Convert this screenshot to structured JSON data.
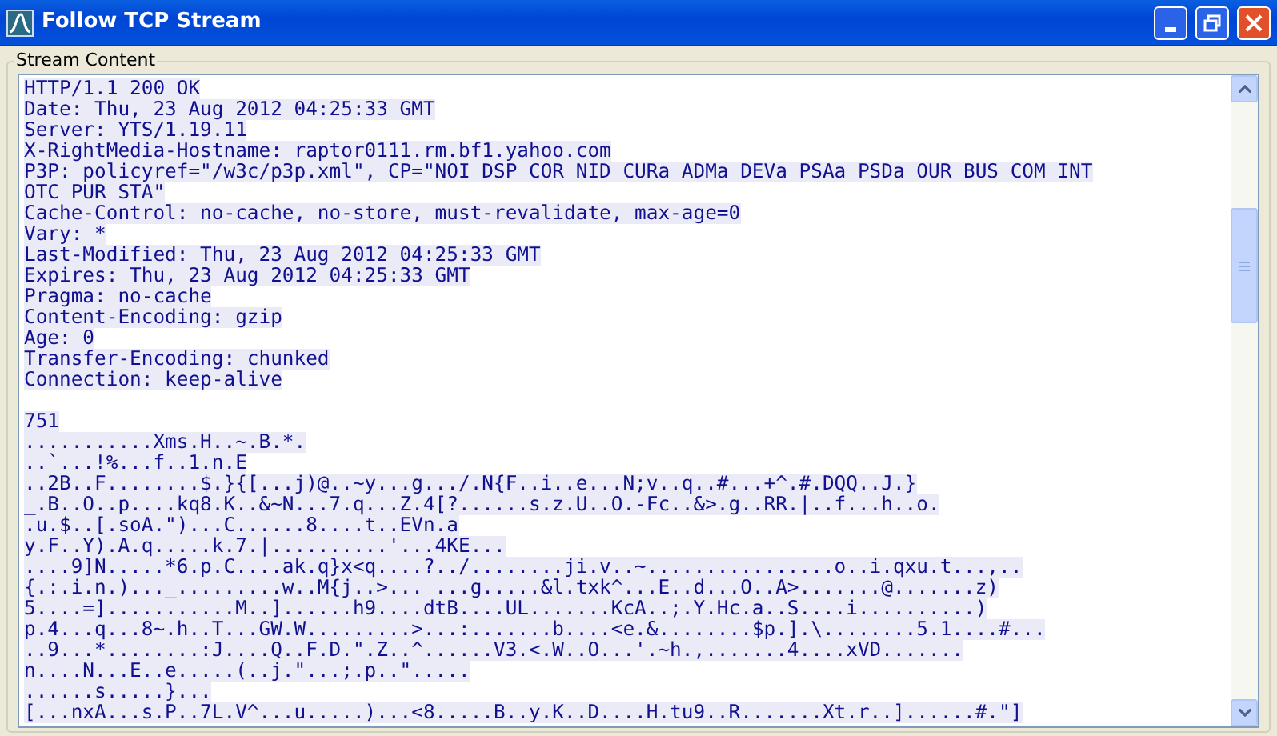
{
  "window": {
    "title": "Follow TCP Stream"
  },
  "group_label": "Stream Content",
  "blocks": [
    {
      "lines": [
        "HTTP/1.1 200 OK",
        "Date: Thu, 23 Aug 2012 04:25:33 GMT",
        "Server: YTS/1.19.11",
        "X-RightMedia-Hostname: raptor0111.rm.bf1.yahoo.com",
        "P3P: policyref=\"/w3c/p3p.xml\", CP=\"NOI DSP COR NID CURa ADMa DEVa PSAa PSDa OUR BUS COM INT",
        "OTC PUR STA\"",
        "Cache-Control: no-cache, no-store, must-revalidate, max-age=0",
        "Vary: *",
        "Last-Modified: Thu, 23 Aug 2012 04:25:33 GMT",
        "Expires: Thu, 23 Aug 2012 04:25:33 GMT",
        "Pragma: no-cache",
        "Content-Encoding: gzip",
        "Age: 0",
        "Transfer-Encoding: chunked",
        "Connection: keep-alive"
      ]
    },
    {
      "lines": [
        "751",
        "...........Xms.H..~.B.*.",
        "..`...!%...f..1.n.E",
        "..2B..F........$.}{[...j)@..~y...g.../.N{F..i..e...N;v..q..#...+^.#.DQQ..J.}",
        "_.B..O..p....kq8.K..&~N...7.q...Z.4[?......s.z.U..O.-Fc..&>.g..RR.|..f...h..o.",
        ".u.$..[.soA.\")...C......8....t..EVn.a",
        "y.F..Y).A.q.....k.7.|..........'...4KE...",
        "....9]N.....*6.p.C....ak.q}x<q....?../........ji.v..~................o..i.qxu.t...,..",
        "{.:.i.n.)..._.........w..M{j..>... ...g.....&l.txk^...E..d...O..A>.......@.......z)",
        "5....=]...........M..]......h9....dtB....UL.......KcA..;.Y.Hc.a..S....i..........)",
        "p.4...q...8~.h..T...GW.W.........>...:.......b....<e.&........$p.].\\........5.1....#...",
        "..9...*........:J....Q..F.D.\".Z..^......V3.<.W..O...'.~h.,.......4....xVD.......",
        "n....N...E..e.....(..j.\"...;.p..\".....",
        "......s.....}...",
        "[...nxA...s.P..7L.V^...u.....)...<8.....B..y.K..D....H.tu9..R.......Xt.r..]......#.\"]"
      ]
    }
  ]
}
